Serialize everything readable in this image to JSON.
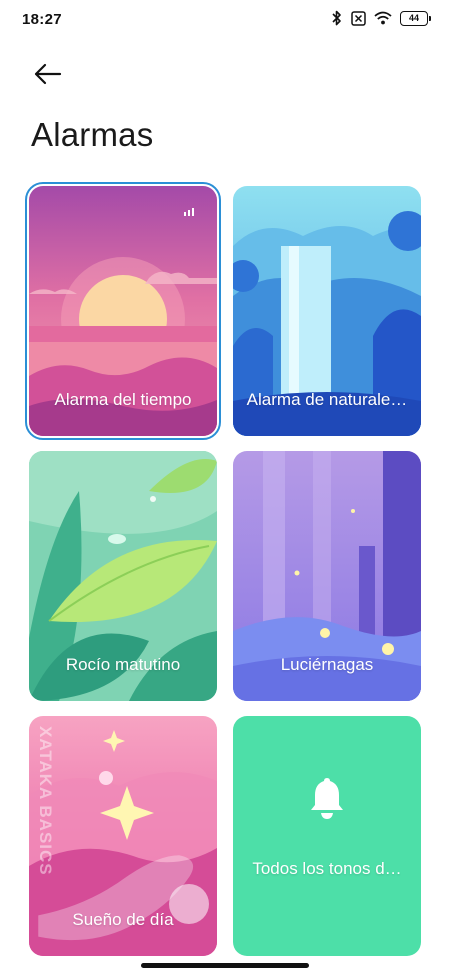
{
  "status_bar": {
    "time": "18:27",
    "battery": "44",
    "icons": [
      "bluetooth-icon",
      "no-sim-icon",
      "wifi-icon",
      "battery-icon"
    ]
  },
  "header": {
    "back_icon": "arrow-left-icon",
    "title": "Alarmas"
  },
  "cards": [
    {
      "label": "Alarma del tiempo",
      "selected": true
    },
    {
      "label": "Alarma de naturale…",
      "selected": false
    },
    {
      "label": "Rocío matutino",
      "selected": false
    },
    {
      "label": "Luciérnagas",
      "selected": false
    },
    {
      "label": "Sueño de día",
      "selected": false
    },
    {
      "label": "Todos los tonos d…",
      "selected": false,
      "icon": "bell-icon"
    }
  ],
  "watermark": "XATAKA BASICS",
  "colors": {
    "accent_selection": "#2b8fd6",
    "all_tones_card": "#4ddfa8"
  }
}
